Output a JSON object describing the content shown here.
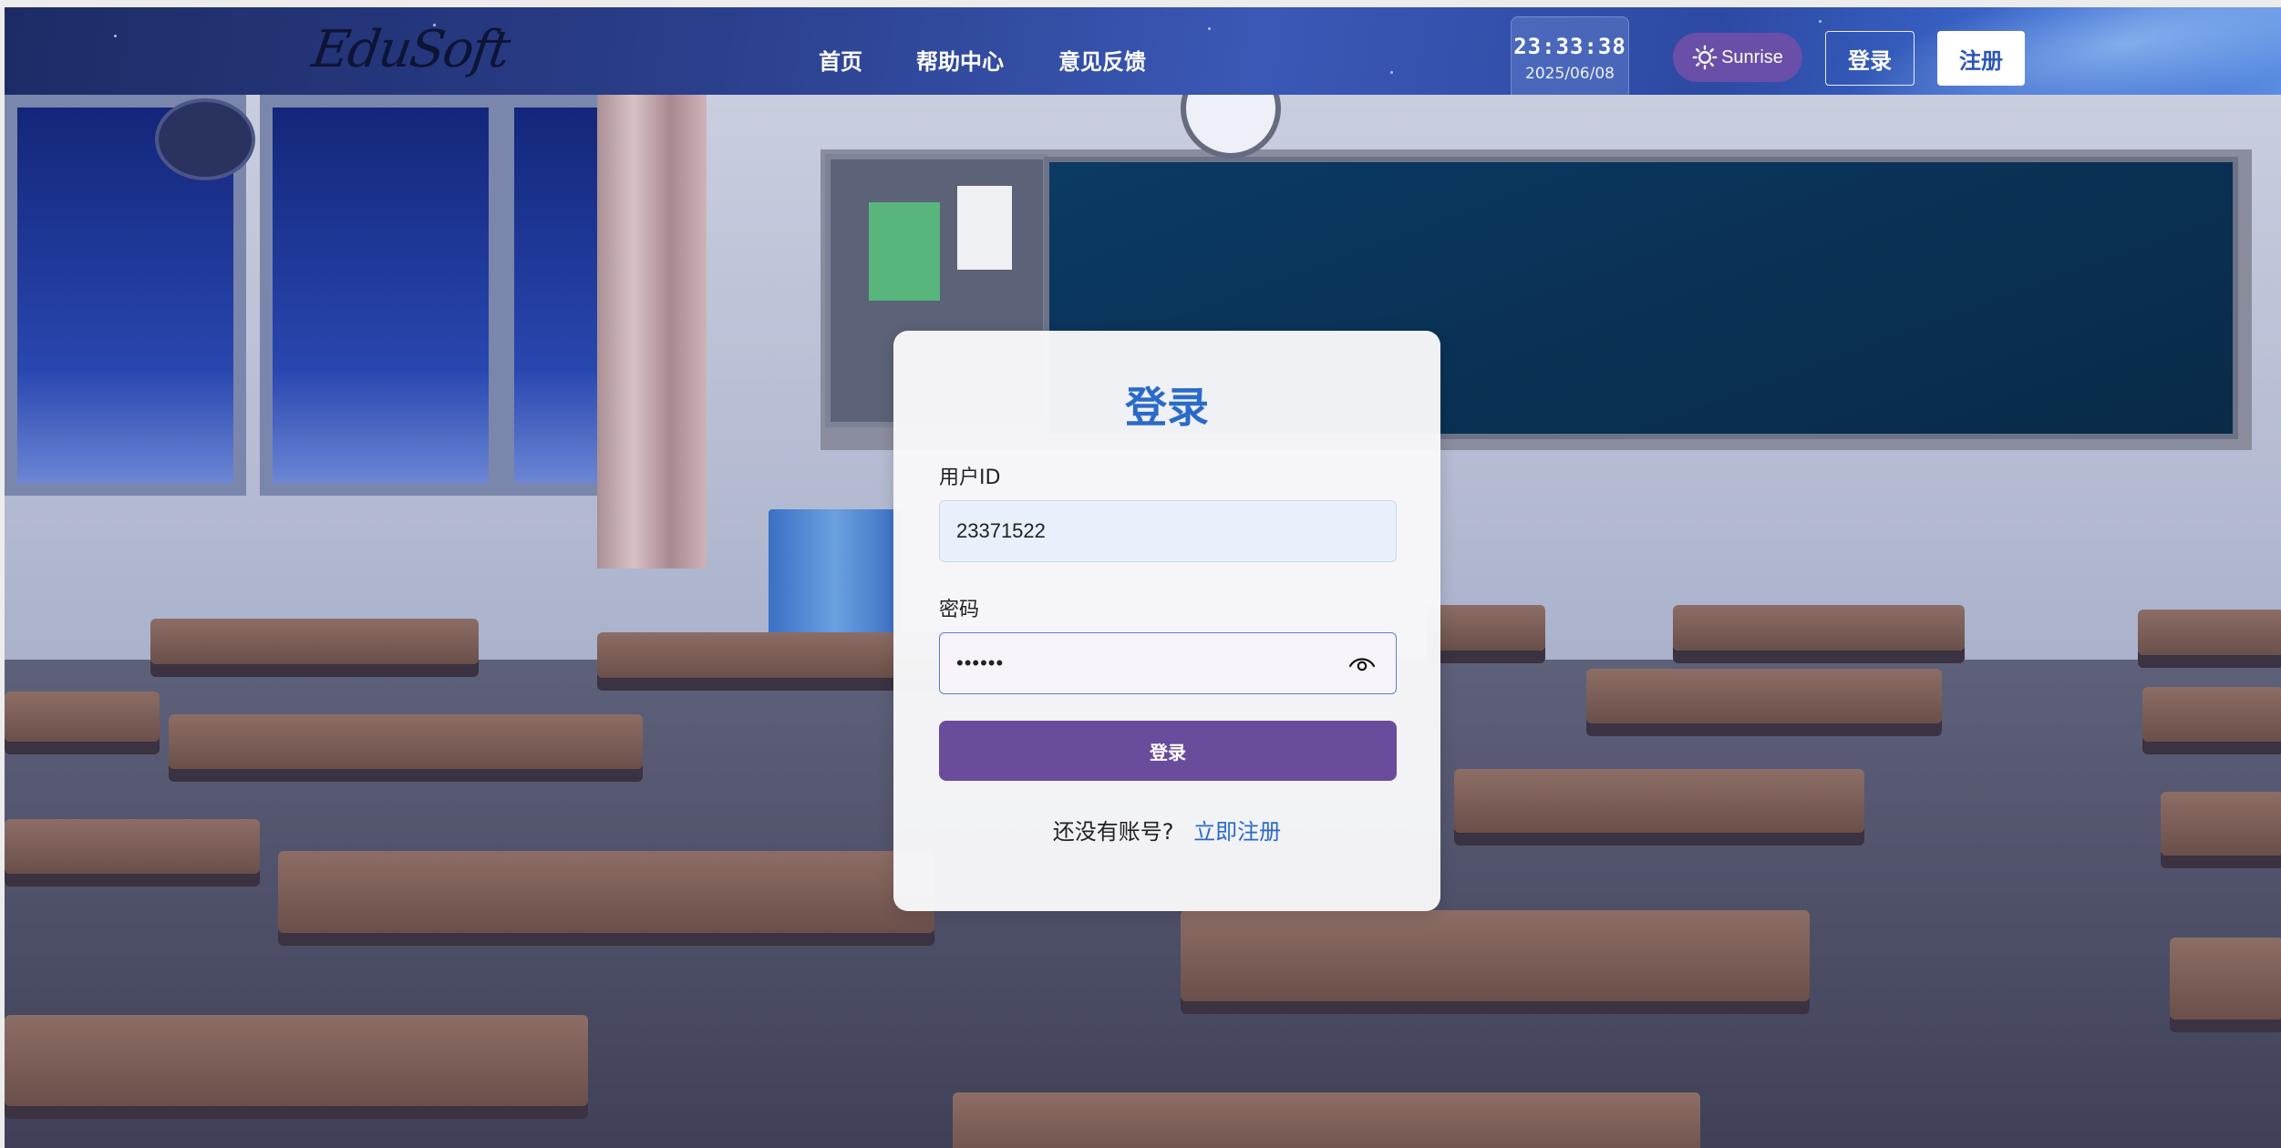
{
  "brand": {
    "logo_text": "EduSoft"
  },
  "nav": {
    "links": [
      "首页",
      "帮助中心",
      "意见反馈"
    ],
    "clock_time": "23:33:38",
    "clock_date": "2025/06/08",
    "theme_label": "Sunrise",
    "login_label": "登录",
    "register_label": "注册"
  },
  "login": {
    "title": "登录",
    "user_label": "用户ID",
    "user_value": "23371522",
    "password_label": "密码",
    "password_value": "••••••",
    "submit_label": "登录",
    "no_account_text": "还没有账号?",
    "register_link": "立即注册"
  },
  "colors": {
    "accent_blue": "#2a6ac9",
    "button_purple": "#6a4c9c",
    "theme_purple": "#6a4fa8"
  }
}
